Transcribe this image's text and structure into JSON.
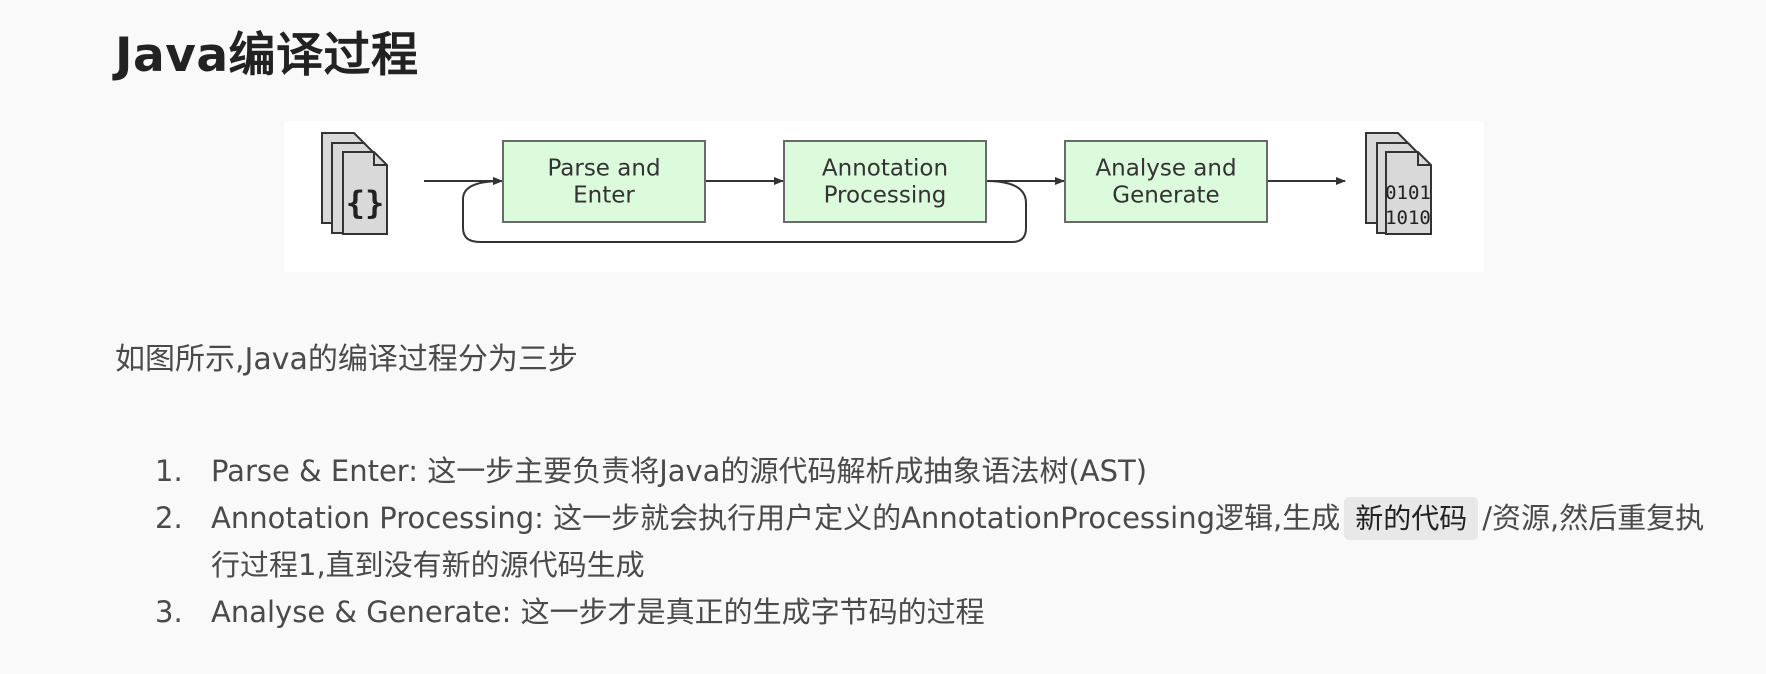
{
  "title": "Java编译过程",
  "diagram": {
    "stages": [
      "Parse and\nEnter",
      "Annotation\nProcessing",
      "Analyse and\nGenerate"
    ],
    "source_icon": "{}",
    "output_icon": [
      "0101",
      "1010"
    ],
    "colors": {
      "box_fill": "#dcfadc",
      "box_stroke": "#6a6a6a",
      "doc_fill": "#d9d9d9",
      "arrow": "#333333"
    }
  },
  "intro": "如图所示,Java的编译过程分为三步",
  "steps": [
    {
      "num": "1.",
      "text": "Parse & Enter: 这一步主要负责将Java的源代码解析成抽象语法树(AST)"
    },
    {
      "num": "2.",
      "text_before": "Annotation Processing: 这一步就会执行用户定义的AnnotationProcessing逻辑,生成",
      "code": "新的代码",
      "text_after": "/资源,然后重复执行过程1,直到没有新的源代码生成"
    },
    {
      "num": "3.",
      "text": "Analyse & Generate: 这一步才是真正的生成字节码的过程"
    }
  ]
}
